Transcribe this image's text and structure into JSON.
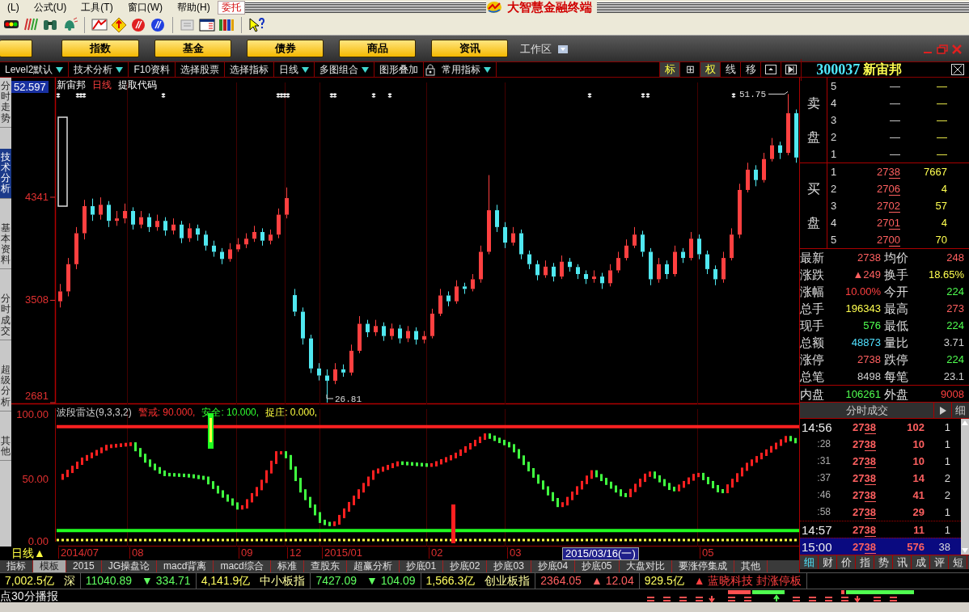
{
  "menu": [
    {
      "label": "(L)"
    },
    {
      "label": "公式(U)"
    },
    {
      "label": "工具(T)"
    },
    {
      "label": "窗口(W)"
    },
    {
      "label": "帮助(H)"
    }
  ],
  "trade_button": "委托",
  "app_title": "大智慧金融终端",
  "nav_buttons": [
    {
      "label": "指数"
    },
    {
      "label": "基金"
    },
    {
      "label": "债券"
    },
    {
      "label": "商品"
    },
    {
      "label": "资讯"
    }
  ],
  "workspace": "工作区",
  "function_tabs": [
    {
      "label": "Level2默认",
      "dropdown": true
    },
    {
      "label": "技术分析",
      "dropdown": true
    },
    {
      "label": "F10资料",
      "dropdown": false
    },
    {
      "label": "选择股票",
      "dropdown": false
    },
    {
      "label": "选择指标",
      "dropdown": false
    },
    {
      "label": "日线",
      "dropdown": true
    },
    {
      "label": "多图组合",
      "dropdown": true
    },
    {
      "label": "图形叠加",
      "dropdown": false
    },
    {
      "label": "常用指标",
      "dropdown": true,
      "kind": "locked"
    }
  ],
  "view_buttons": [
    {
      "label": "标",
      "selected": true
    },
    {
      "label": "⊞",
      "selected": false
    },
    {
      "label": "权",
      "selected": true
    },
    {
      "label": "线",
      "selected": false
    },
    {
      "label": "移",
      "selected": false
    }
  ],
  "stock": {
    "code": "300037",
    "name": "新宙邦"
  },
  "side_tabs": [
    {
      "label": "分时走势",
      "selected": false
    },
    {
      "label": "技术分析",
      "selected": true
    },
    {
      "label": "基本资料",
      "selected": false
    },
    {
      "label": "分时成交",
      "selected": false
    },
    {
      "label": "超级分析",
      "selected": false
    },
    {
      "label": "其他",
      "selected": false
    }
  ],
  "price_chart": {
    "legend": [
      {
        "text": "新宙邦",
        "kind": "label"
      },
      {
        "text": "日线",
        "kind": "period"
      },
      {
        "text": "提取代码",
        "kind": "label"
      }
    ],
    "price_cursor": "52.597",
    "high_label": "51.75",
    "low_label": "26.81",
    "chart_data": {
      "type": "candlestick",
      "ylim": [
        2668,
        5308
      ],
      "yticks": [
        {
          "value": 4341,
          "label": "4341"
        },
        {
          "value": 3508,
          "label": "3508"
        },
        {
          "value": 2681,
          "label": "2681"
        }
      ],
      "categories": [
        null,
        null,
        null,
        null,
        null,
        null,
        null,
        null,
        null,
        null,
        null,
        null,
        null,
        null,
        null,
        null,
        null,
        null,
        null,
        null,
        null,
        null,
        null,
        null,
        null,
        null,
        null,
        null,
        null,
        null,
        null,
        null,
        null,
        null,
        null,
        null,
        null,
        null,
        null,
        null,
        null,
        null,
        null,
        null,
        null,
        null,
        null,
        null,
        null,
        null,
        null,
        null,
        null,
        null,
        null,
        null,
        null,
        null,
        null,
        null,
        null,
        null,
        null,
        null,
        null,
        null,
        null,
        null,
        null,
        null,
        null,
        null,
        null,
        null,
        null,
        null,
        null,
        null,
        null,
        null,
        null,
        null,
        null,
        null,
        null,
        null,
        null,
        null,
        null,
        null,
        null,
        null
      ],
      "ohlc": [
        [
          3500,
          3640,
          3450,
          3580
        ],
        [
          3580,
          3850,
          3540,
          3800
        ],
        [
          3800,
          4100,
          3760,
          4050
        ],
        [
          4050,
          4320,
          4000,
          4269
        ],
        [
          4269,
          4330,
          4150,
          4200
        ],
        [
          4200,
          4340,
          4160,
          4280
        ],
        [
          4280,
          4310,
          4100,
          4150
        ],
        [
          4150,
          4230,
          4110,
          4170
        ],
        [
          4170,
          4290,
          4130,
          4230
        ],
        [
          4230,
          4260,
          4080,
          4120
        ],
        [
          4120,
          4230,
          4090,
          4180
        ],
        [
          4180,
          4210,
          4060,
          4100
        ],
        [
          4100,
          4200,
          4070,
          4150
        ],
        [
          4150,
          4180,
          4030,
          4072
        ],
        [
          4072,
          4170,
          4040,
          4120
        ],
        [
          4120,
          4150,
          3970,
          4010
        ],
        [
          4010,
          4130,
          3980,
          4090
        ],
        [
          4090,
          4120,
          3990,
          4039
        ],
        [
          4039,
          4070,
          3910,
          3950
        ],
        [
          3950,
          3990,
          3860,
          3900
        ],
        [
          3900,
          3930,
          3800,
          3842
        ],
        [
          3842,
          3970,
          3820,
          3920
        ],
        [
          3920,
          4010,
          3900,
          3960
        ],
        [
          3960,
          4050,
          3930,
          4006
        ],
        [
          4006,
          4110,
          3980,
          4060
        ],
        [
          4060,
          4090,
          3950,
          3990
        ],
        [
          3990,
          4080,
          3960,
          4039
        ],
        [
          4039,
          4250,
          4010,
          4200
        ],
        [
          4200,
          4420,
          4170,
          4334
        ],
        [
          3550,
          3600,
          3380,
          3416
        ],
        [
          3416,
          3450,
          3150,
          3200
        ],
        [
          3200,
          3230,
          2920,
          2957
        ],
        [
          2957,
          3000,
          2860,
          2900
        ],
        [
          2900,
          2950,
          2681,
          2858
        ],
        [
          2858,
          3000,
          2830,
          2950
        ],
        [
          2950,
          2990,
          2890,
          2924
        ],
        [
          2924,
          3150,
          2900,
          3100
        ],
        [
          3100,
          3380,
          3080,
          3318
        ],
        [
          3318,
          3350,
          3210,
          3250
        ],
        [
          3250,
          3350,
          3220,
          3300
        ],
        [
          3300,
          3330,
          3180,
          3219
        ],
        [
          3219,
          3320,
          3190,
          3280
        ],
        [
          3280,
          3310,
          3160,
          3200
        ],
        [
          3200,
          3300,
          3170,
          3260
        ],
        [
          3260,
          3290,
          3150,
          3190
        ],
        [
          3190,
          3260,
          3160,
          3219
        ],
        [
          3219,
          3440,
          3200,
          3400
        ],
        [
          3400,
          3600,
          3380,
          3547
        ],
        [
          3547,
          3580,
          3460,
          3500
        ],
        [
          3500,
          3670,
          3480,
          3620
        ],
        [
          3620,
          3650,
          3560,
          3600
        ],
        [
          3600,
          3720,
          3580,
          3678
        ],
        [
          3678,
          3950,
          3650,
          3900
        ],
        [
          3900,
          4520,
          3880,
          4236
        ],
        [
          4236,
          4280,
          4060,
          4100
        ],
        [
          4100,
          4140,
          3930,
          3974
        ],
        [
          3974,
          4100,
          3950,
          4050
        ],
        [
          4050,
          4080,
          3840,
          3880
        ],
        [
          3880,
          3910,
          3760,
          3800
        ],
        [
          3800,
          3830,
          3670,
          3711
        ],
        [
          3711,
          3830,
          3690,
          3780
        ],
        [
          3780,
          3810,
          3660,
          3700
        ],
        [
          3700,
          3870,
          3680,
          3820
        ],
        [
          3820,
          3850,
          3740,
          3777
        ],
        [
          3777,
          3800,
          3680,
          3720
        ],
        [
          3720,
          3750,
          3640,
          3680
        ],
        [
          3680,
          3750,
          3650,
          3700
        ],
        [
          3700,
          3730,
          3600,
          3646
        ],
        [
          3646,
          3800,
          3620,
          3750
        ],
        [
          3750,
          3900,
          3730,
          3850
        ],
        [
          3850,
          4000,
          3830,
          3950
        ],
        [
          3950,
          4100,
          3930,
          4039
        ],
        [
          4039,
          4070,
          3860,
          3900
        ],
        [
          3900,
          3930,
          3630,
          3678
        ],
        [
          3678,
          3850,
          3650,
          3800
        ],
        [
          3800,
          3830,
          3680,
          3720
        ],
        [
          3720,
          3950,
          3700,
          3900
        ],
        [
          3900,
          3930,
          3810,
          3850
        ],
        [
          3850,
          4060,
          3830,
          4006
        ],
        [
          4006,
          4040,
          3840,
          3880
        ],
        [
          3880,
          3910,
          3720,
          3760
        ],
        [
          3760,
          3790,
          3630,
          3678
        ],
        [
          3678,
          3900,
          3650,
          3850
        ],
        [
          3850,
          4090,
          3830,
          4039
        ],
        [
          4039,
          4450,
          4010,
          4400
        ],
        [
          4400,
          4620,
          4380,
          4564
        ],
        [
          4564,
          4600,
          4430,
          4480
        ],
        [
          4480,
          4700,
          4460,
          4650
        ],
        [
          4650,
          4820,
          4630,
          4761
        ],
        [
          4761,
          4790,
          4650,
          4700
        ],
        [
          4700,
          5175,
          4680,
          5020
        ],
        [
          5020,
          5050,
          4620,
          4662
        ]
      ]
    }
  },
  "indicator": {
    "legend": [
      {
        "text": "波段雷达(9,3,3,2)",
        "color": "#d0d0d0"
      },
      {
        "text": "警戒: 90.000,",
        "color": "#ff3030"
      },
      {
        "text": "安全: 10.000,",
        "color": "#30ff30"
      },
      {
        "text": "捉庄: 0.000,",
        "color": "#ffff40"
      }
    ],
    "axis_labels": [
      "100.00",
      "50.00",
      "0.00"
    ]
  },
  "period": "日线▲",
  "date_axis": [
    {
      "label": "2014/07",
      "kind": "month"
    },
    {
      "label": "08",
      "kind": "month"
    },
    {
      "label": "09",
      "kind": "month"
    },
    {
      "label": "12",
      "kind": "month"
    },
    {
      "label": "2015/01",
      "kind": "month"
    },
    {
      "label": "02",
      "kind": "month"
    },
    {
      "label": "03",
      "kind": "month"
    },
    {
      "label": "2015/03/16(一)",
      "kind": "cursor"
    },
    {
      "label": "05",
      "kind": "month"
    }
  ],
  "indicator_tabs": [
    {
      "label": "指标",
      "selected": false
    },
    {
      "label": "模板",
      "selected": true
    },
    {
      "label": "2015",
      "selected": false
    },
    {
      "label": "JG操盘论",
      "selected": false
    },
    {
      "label": "macd背离",
      "selected": false
    },
    {
      "label": "macd综合",
      "selected": false
    },
    {
      "label": "标准",
      "selected": false
    },
    {
      "label": "查股东",
      "selected": false
    },
    {
      "label": "超赢分析",
      "selected": false
    },
    {
      "label": "抄底01",
      "selected": false
    },
    {
      "label": "抄底02",
      "selected": false
    },
    {
      "label": "抄底03",
      "selected": false
    },
    {
      "label": "抄底04",
      "selected": false
    },
    {
      "label": "抄底05",
      "selected": false
    },
    {
      "label": "大盘对比",
      "selected": false
    },
    {
      "label": "要涨停集成",
      "selected": false
    },
    {
      "label": "其他",
      "selected": false
    }
  ],
  "quote": {
    "ask_title": "卖盘",
    "bid_title": "买盘",
    "ask": [
      {
        "level": "5",
        "price": "—",
        "volume": "—"
      },
      {
        "level": "4",
        "price": "—",
        "volume": "—"
      },
      {
        "level": "3",
        "price": "—",
        "volume": "—"
      },
      {
        "level": "2",
        "price": "—",
        "volume": "—"
      },
      {
        "level": "1",
        "price": "—",
        "volume": "—"
      }
    ],
    "bid": [
      {
        "level": "1",
        "price": "2738",
        "volume": "7667"
      },
      {
        "level": "2",
        "price": "2706",
        "volume": "4"
      },
      {
        "level": "3",
        "price": "2702",
        "volume": "57"
      },
      {
        "level": "4",
        "price": "2701",
        "volume": "4"
      },
      {
        "level": "5",
        "price": "2700",
        "volume": "70"
      }
    ]
  },
  "stats": [
    [
      {
        "label": "最新",
        "value": "2738",
        "color": "#ff6060"
      },
      {
        "label": "均价",
        "value": "248",
        "color": "#ff6060"
      }
    ],
    [
      {
        "label": "涨跌",
        "value": "▲249",
        "color": "#ff6060"
      },
      {
        "label": "换手",
        "value": "18.65%",
        "color": "#ffff50"
      }
    ],
    [
      {
        "label": "涨幅",
        "value": "10.00%",
        "color": "#ff4040"
      },
      {
        "label": "今开",
        "value": "224",
        "color": "#50ff50"
      }
    ],
    [
      {
        "label": "总手",
        "value": "196343",
        "color": "#ffff50"
      },
      {
        "label": "最高",
        "value": "273",
        "color": "#ff6060"
      }
    ],
    [
      {
        "label": "现手",
        "value": "576",
        "color": "#50ff50"
      },
      {
        "label": "最低",
        "value": "224",
        "color": "#50ff50"
      }
    ],
    [
      {
        "label": "总额",
        "value": "48873",
        "color": "#50e0ff"
      },
      {
        "label": "量比",
        "value": "3.71",
        "color": "#d0d0d0"
      }
    ],
    [
      {
        "label": "涨停",
        "value": "2738",
        "color": "#ff6060"
      },
      {
        "label": "跌停",
        "value": "224",
        "color": "#50ff50"
      }
    ],
    [
      {
        "label": "总笔",
        "value": "8498",
        "color": "#d0d0d0"
      },
      {
        "label": "每笔",
        "value": "23.1",
        "color": "#d0d0d0"
      }
    ],
    [
      {
        "label": "内盘",
        "value": "106261",
        "color": "#50ff50"
      },
      {
        "label": "外盘",
        "value": "9008",
        "color": "#ff4040"
      }
    ]
  ],
  "ticks_panel": {
    "title": "分时成交",
    "detail": "细"
  },
  "ticks": [
    {
      "time": "14:56",
      "kind": "minute",
      "price": "2738",
      "volume": "102",
      "count": "1",
      "selected": false
    },
    {
      "time": ":28",
      "kind": "second",
      "price": "2738",
      "volume": "10",
      "count": "1",
      "selected": false
    },
    {
      "time": ":31",
      "kind": "second",
      "price": "2738",
      "volume": "10",
      "count": "1",
      "selected": false
    },
    {
      "time": ":37",
      "kind": "second",
      "price": "2738",
      "volume": "14",
      "count": "2",
      "selected": false
    },
    {
      "time": ":46",
      "kind": "second",
      "price": "2738",
      "volume": "41",
      "count": "2",
      "selected": false
    },
    {
      "time": ":58",
      "kind": "second",
      "price": "2738",
      "volume": "29",
      "count": "1",
      "selected": false
    },
    {
      "time": "14:57",
      "kind": "minute",
      "price": "2738",
      "volume": "11",
      "count": "1",
      "selected": false
    },
    {
      "time": "15:00",
      "kind": "minute",
      "price": "2738",
      "volume": "576",
      "count": "38",
      "selected": true
    }
  ],
  "panel_tabs": [
    {
      "label": "细",
      "selected": true
    },
    {
      "label": "财",
      "selected": false
    },
    {
      "label": "价",
      "selected": false
    },
    {
      "label": "指",
      "selected": false
    },
    {
      "label": "势",
      "selected": false
    },
    {
      "label": "讯",
      "selected": false
    },
    {
      "label": "成",
      "selected": false
    },
    {
      "label": "评",
      "selected": false
    },
    {
      "label": "短",
      "selected": false
    }
  ],
  "ticker": [
    {
      "text": "7,002.5亿",
      "color": "#ffff60"
    },
    {
      "text": "深",
      "color": "#ffffa0"
    },
    {
      "text": "11040.89",
      "color": "#60ff60"
    },
    {
      "text": "▼ 334.71",
      "color": "#60ff60"
    },
    {
      "text": "4,141.9亿",
      "color": "#ffff60"
    },
    {
      "text": "中小板指",
      "color": "#ffffa0"
    },
    {
      "text": "7427.09",
      "color": "#60ff60"
    },
    {
      "text": "▼ 104.09",
      "color": "#60ff60"
    },
    {
      "text": "1,566.3亿",
      "color": "#ffff60"
    },
    {
      "text": "创业板指",
      "color": "#ffffa0"
    },
    {
      "text": "2364.05",
      "color": "#ff6060"
    },
    {
      "text": "▲ 12.04",
      "color": "#ff6060"
    },
    {
      "text": "929.5亿",
      "color": "#ffff60"
    },
    {
      "text": "▲ 蓝晓科技 封涨停板",
      "color": "#ff4040"
    }
  ],
  "news": "点30分播报"
}
